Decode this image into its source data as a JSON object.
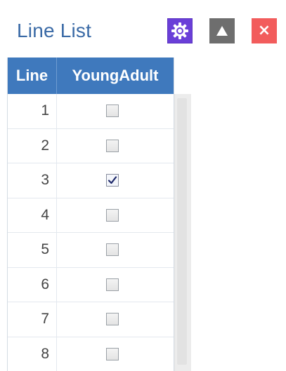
{
  "panel": {
    "title": "Line List",
    "buttons": {
      "settings": {
        "icon": "gear-icon",
        "color": "#6a3fd8"
      },
      "collapse": {
        "icon": "triangle-up-icon",
        "color": "#6e6e6e"
      },
      "close": {
        "icon": "close-icon",
        "label": "×",
        "color": "#f25c5c"
      }
    }
  },
  "table": {
    "header_color": "#3f79bd",
    "columns": [
      "Line",
      "YoungAdult"
    ],
    "rows": [
      {
        "line": "1",
        "young_adult": false
      },
      {
        "line": "2",
        "young_adult": false
      },
      {
        "line": "3",
        "young_adult": true
      },
      {
        "line": "4",
        "young_adult": false
      },
      {
        "line": "5",
        "young_adult": false
      },
      {
        "line": "6",
        "young_adult": false
      },
      {
        "line": "7",
        "young_adult": false
      },
      {
        "line": "8",
        "young_adult": false
      }
    ]
  }
}
